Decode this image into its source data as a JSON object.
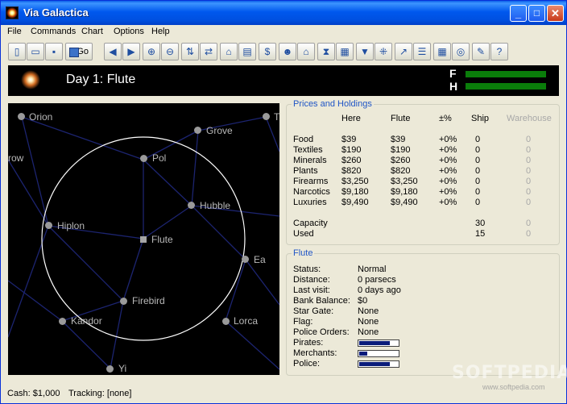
{
  "window": {
    "title": "Via Galactica",
    "minimize": "_",
    "maximize": "□",
    "close": "✕"
  },
  "menu": {
    "items": [
      "File",
      "Commands",
      "Chart",
      "Options",
      "Help"
    ]
  },
  "toolbar": {
    "go_label": "Go",
    "icons": [
      "new-icon",
      "open-icon",
      "save-icon",
      "go-icon",
      "back-icon",
      "forward-icon",
      "zoom-in-icon",
      "zoom-out-icon",
      "trade-icon",
      "exchange-icon",
      "ship-icon",
      "finance-icon",
      "dollar-icon",
      "crew-icon",
      "home-icon",
      "hourglass-icon",
      "book-icon",
      "filter-icon",
      "network-icon",
      "chart-icon",
      "list-icon",
      "grid-icon",
      "globe-icon",
      "notes-icon",
      "help-icon"
    ]
  },
  "header": {
    "day_title": "Day 1: Flute",
    "f_label": "F",
    "h_label": "H",
    "fuel_level": 1.0,
    "hull_level": 1.0
  },
  "map": {
    "current_system": "Flute",
    "stars": [
      {
        "name": "Orion",
        "current": false
      },
      {
        "name": "Grove",
        "current": false
      },
      {
        "name": "T",
        "current": false
      },
      {
        "name": "row",
        "current": false
      },
      {
        "name": "Pol",
        "current": false
      },
      {
        "name": "Hubble",
        "current": false
      },
      {
        "name": "Hiplon",
        "current": false
      },
      {
        "name": "Flute",
        "current": true
      },
      {
        "name": "Ea",
        "current": false
      },
      {
        "name": "Firebird",
        "current": false
      },
      {
        "name": "Kandor",
        "current": false
      },
      {
        "name": "Lorca",
        "current": false
      },
      {
        "name": "Yi",
        "current": false
      }
    ]
  },
  "prices": {
    "group_title": "Prices and Holdings",
    "columns": [
      "Here",
      "Flute",
      "±%",
      "Ship",
      "Warehouse"
    ],
    "rows": [
      {
        "item": "Food",
        "here": "$39",
        "flute": "$39",
        "pct": "+0%",
        "ship": "0",
        "warehouse": "0"
      },
      {
        "item": "Textiles",
        "here": "$190",
        "flute": "$190",
        "pct": "+0%",
        "ship": "0",
        "warehouse": "0"
      },
      {
        "item": "Minerals",
        "here": "$260",
        "flute": "$260",
        "pct": "+0%",
        "ship": "0",
        "warehouse": "0"
      },
      {
        "item": "Plants",
        "here": "$820",
        "flute": "$820",
        "pct": "+0%",
        "ship": "0",
        "warehouse": "0"
      },
      {
        "item": "Firearms",
        "here": "$3,250",
        "flute": "$3,250",
        "pct": "+0%",
        "ship": "0",
        "warehouse": "0"
      },
      {
        "item": "Narcotics",
        "here": "$9,180",
        "flute": "$9,180",
        "pct": "+0%",
        "ship": "0",
        "warehouse": "0"
      },
      {
        "item": "Luxuries",
        "here": "$9,490",
        "flute": "$9,490",
        "pct": "+0%",
        "ship": "0",
        "warehouse": "0"
      }
    ],
    "capacity": {
      "label": "Capacity",
      "ship": "30",
      "warehouse": "0"
    },
    "used": {
      "label": "Used",
      "ship": "15",
      "warehouse": "0"
    }
  },
  "system": {
    "group_title": "Flute",
    "fields": [
      {
        "label": "Status:",
        "value": "Normal"
      },
      {
        "label": "Distance:",
        "value": "0 parsecs"
      },
      {
        "label": "Last visit:",
        "value": "0 days ago"
      },
      {
        "label": "Bank Balance:",
        "value": "$0"
      },
      {
        "label": "Star Gate:",
        "value": "None"
      },
      {
        "label": "Flag:",
        "value": "None"
      },
      {
        "label": "Police Orders:",
        "value": "None"
      }
    ],
    "meters": [
      {
        "label": "Pirates:",
        "level": 0.8
      },
      {
        "label": "Merchants:",
        "level": 0.2
      },
      {
        "label": "Police:",
        "level": 0.8
      }
    ]
  },
  "status": {
    "cash": "Cash: $1,000",
    "tracking": "Tracking: [none]"
  },
  "watermark": {
    "brand": "SOFTPEDIA",
    "url": "www.softpedia.com"
  }
}
